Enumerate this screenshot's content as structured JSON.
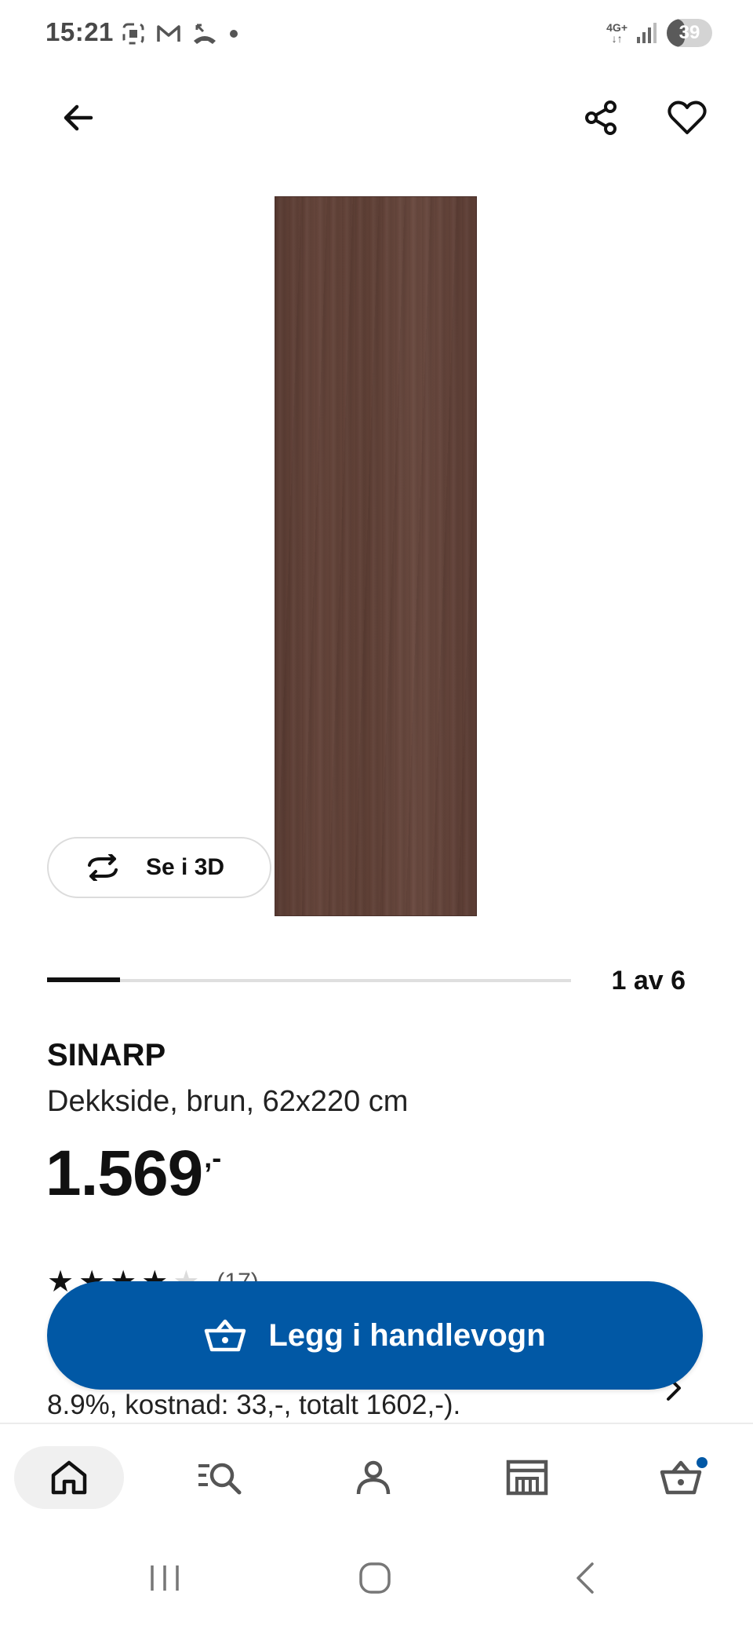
{
  "status_bar": {
    "time": "15:21",
    "network": "4G+",
    "battery": "39",
    "battery_level": 0.39
  },
  "header": {
    "back_icon": "arrow-left-icon",
    "share_icon": "share-icon",
    "favorite_icon": "heart-icon"
  },
  "gallery": {
    "view_3d_label": "Se i 3D",
    "counter": "1 av 6",
    "current": 1,
    "total": 6
  },
  "product": {
    "name": "SINARP",
    "description": "Dekkside, brun, 62x220 cm",
    "price": "1.569",
    "price_suffix": ",-",
    "rating": 4,
    "rating_max": 5,
    "rating_count": "(17)",
    "financing_text": "8.9%, kostnad: 33,-, totalt 1602,-)."
  },
  "actions": {
    "add_to_cart": "Legg i handlevogn"
  },
  "bottom_nav": {
    "items": [
      {
        "icon": "home-icon",
        "active": true
      },
      {
        "icon": "search-list-icon",
        "active": false
      },
      {
        "icon": "profile-icon",
        "active": false
      },
      {
        "icon": "store-icon",
        "active": false
      },
      {
        "icon": "cart-icon",
        "active": false,
        "badge": true
      }
    ]
  },
  "colors": {
    "primary": "#0158a5",
    "wood": "#5f4036"
  }
}
